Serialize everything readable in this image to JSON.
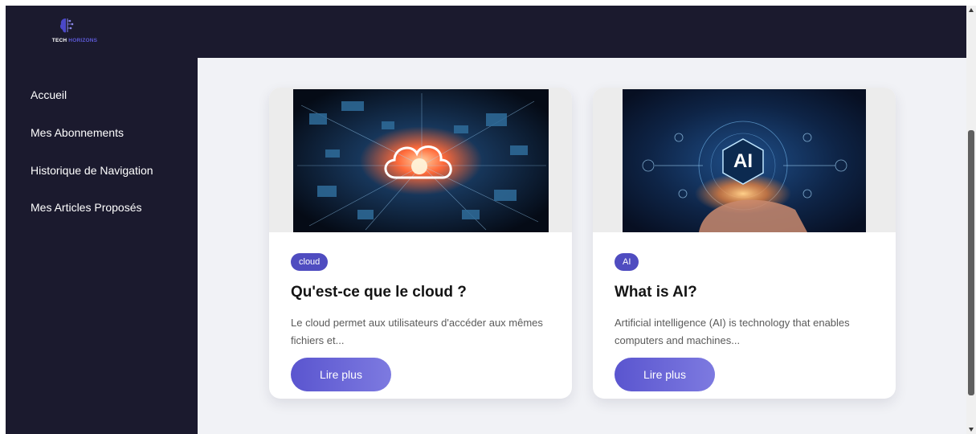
{
  "brand": {
    "logo_primary": "TECH",
    "logo_secondary": "HORIZONS",
    "logo_icon": "brain-circuit-icon"
  },
  "sidebar": {
    "items": [
      {
        "label": "Accueil"
      },
      {
        "label": "Mes Abonnements"
      },
      {
        "label": "Historique de Navigation"
      },
      {
        "label": "Mes Articles Proposés"
      }
    ]
  },
  "articles": [
    {
      "tag": "cloud",
      "title": "Qu'est-ce que le cloud ?",
      "excerpt": "Le cloud permet aux utilisateurs d'accéder aux mêmes fichiers et...",
      "cta": "Lire plus",
      "image_icon": "cloud-network-image"
    },
    {
      "tag": "AI",
      "title": "What is AI?",
      "excerpt": "Artificial intelligence (AI) is technology that enables computers and machines...",
      "cta": "Lire plus",
      "image_icon": "ai-hand-image",
      "image_text": "AI"
    }
  ],
  "colors": {
    "nav_background": "#1b1a2e",
    "accent": "#4f4cc0",
    "content_background": "#f1f2f6"
  }
}
